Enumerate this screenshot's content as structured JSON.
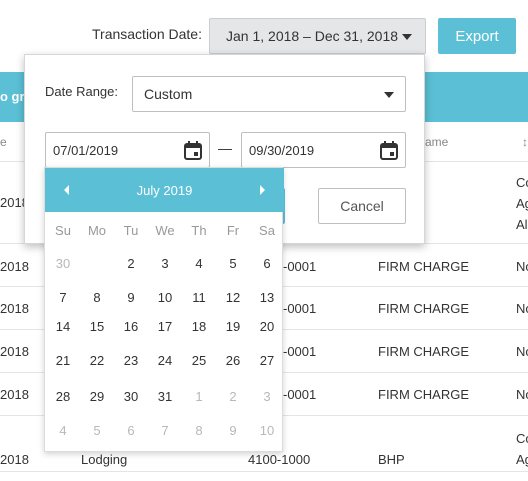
{
  "toolbar": {
    "transaction_date_label": "Transaction Date:",
    "date_range_value": "Jan 1, 2018 – Dec 31, 2018",
    "export_label": "Export"
  },
  "table": {
    "bar_fragment": "o gr",
    "header_fragment_left": "e",
    "header_fragment_name": "ame",
    "header_fragment_right": "↕",
    "rows": [
      {
        "date": "2018",
        "desc": "",
        "code": "",
        "name": "",
        "extra": "Co",
        "extra2": "Ag",
        "extra3": "Al"
      },
      {
        "date": "2018",
        "desc": "",
        "code": "-0001",
        "name": "FIRM CHARGE",
        "extra": "No"
      },
      {
        "date": "2018",
        "desc": "",
        "code": "-0001",
        "name": "FIRM CHARGE",
        "extra": "No"
      },
      {
        "date": "2018",
        "desc": "",
        "code": "-0001",
        "name": "FIRM CHARGE",
        "extra": "No"
      },
      {
        "date": "2018",
        "desc": "",
        "code": "-0001",
        "name": "FIRM CHARGE",
        "extra": "No"
      },
      {
        "date": "2018",
        "desc": "Lodging",
        "code": "4100-1000",
        "name": "BHP",
        "extra": "Co",
        "extra2": "Ag"
      }
    ]
  },
  "panel": {
    "range_label": "Date Range:",
    "range_value": "Custom",
    "start_date": "07/01/2019",
    "end_date": "09/30/2019",
    "dash": "—",
    "cancel_label": "Cancel"
  },
  "calendar": {
    "month_title": "July 2019",
    "weekdays": [
      "Su",
      "Mo",
      "Tu",
      "We",
      "Th",
      "Fr",
      "Sa"
    ],
    "weeks": [
      [
        "30",
        "1",
        "2",
        "3",
        "4",
        "5",
        "6"
      ],
      [
        "7",
        "8",
        "9",
        "10",
        "11",
        "12",
        "13"
      ],
      [
        "14",
        "15",
        "16",
        "17",
        "18",
        "19",
        "20"
      ],
      [
        "21",
        "22",
        "23",
        "24",
        "25",
        "26",
        "27"
      ],
      [
        "28",
        "29",
        "30",
        "31",
        "1",
        "2",
        "3"
      ],
      [
        "4",
        "5",
        "6",
        "7",
        "8",
        "9",
        "10"
      ]
    ],
    "muted": [
      [
        0,
        0
      ],
      [
        4,
        4
      ],
      [
        4,
        5
      ],
      [
        4,
        6
      ],
      [
        5,
        0
      ],
      [
        5,
        1
      ],
      [
        5,
        2
      ],
      [
        5,
        3
      ],
      [
        5,
        4
      ],
      [
        5,
        5
      ],
      [
        5,
        6
      ]
    ],
    "selected": [
      0,
      1
    ]
  },
  "colors": {
    "accent": "#5bc0d6"
  }
}
